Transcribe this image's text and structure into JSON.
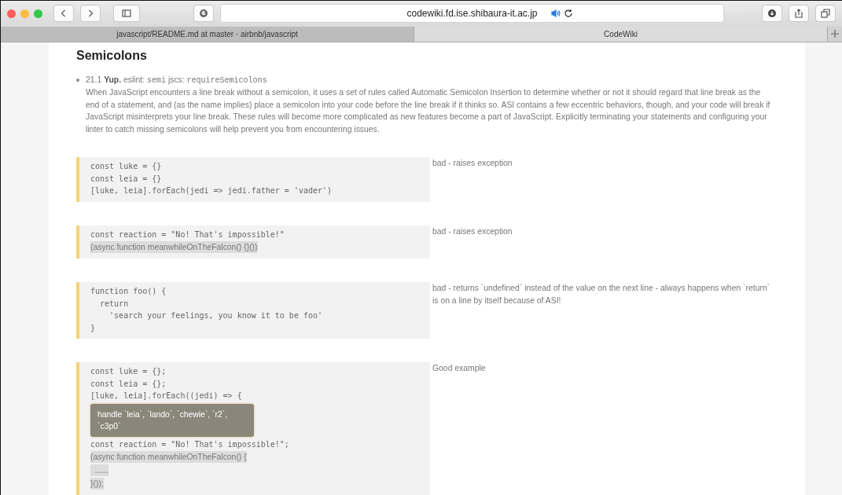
{
  "toolbar": {
    "url": "codewiki.fd.ise.shibaura-it.ac.jp"
  },
  "tabs": [
    {
      "label": "javascript/README.md at master · airbnb/javascript",
      "selected": false
    },
    {
      "label": "CodeWiki",
      "selected": true
    }
  ],
  "heading": "Semicolons",
  "rule": {
    "number": "21.1",
    "title": "Yup.",
    "eslint_label": "eslint:",
    "eslint_rule": "semi",
    "jscs_label": "jscs:",
    "jscs_rule": "requireSemicolons",
    "text": "When JavaScript encounters a line break without a semicolon, it uses a set of rules called Automatic Semicolon Insertion to determine whether or not it should regard that line break as the end of a statement, and (as the name implies) place a semicolon into your code before the line break if it thinks so. ASI contains a few eccentric behaviors, though, and your code will break if JavaScript misinterprets your line break. These rules will become more complicated as new features become a part of JavaScript. Explicitly terminating your statements and configuring your linter to catch missing semicolons will help prevent you from encountering issues."
  },
  "examples": [
    {
      "note": "bad - raises exception",
      "lines": [
        {
          "kind": "code",
          "text": "const luke = {}"
        },
        {
          "kind": "code",
          "text": "const leia = {}"
        },
        {
          "kind": "code",
          "text": "[luke, leia].forEach(jedi => jedi.father = 'vader')"
        }
      ]
    },
    {
      "note": "bad - raises exception",
      "lines": [
        {
          "kind": "code",
          "text": "const reaction = \"No! That's impossible!\""
        },
        {
          "kind": "highlight",
          "text": "(async function meanwhileOnTheFalcon() {}())"
        }
      ]
    },
    {
      "note": "bad - returns `undefined` instead of the value on the next line - always happens when `return` is on a line by itself because of ASI!",
      "lines": [
        {
          "kind": "code",
          "text": "function foo() {"
        },
        {
          "kind": "code",
          "text": "  return"
        },
        {
          "kind": "code",
          "text": "    'search your feelings, you know it to be foo'"
        },
        {
          "kind": "code",
          "text": "}"
        }
      ]
    },
    {
      "note": "Good example",
      "lines": [
        {
          "kind": "code",
          "text": "const luke = {};"
        },
        {
          "kind": "code",
          "text": "const leia = {};"
        },
        {
          "kind": "code",
          "text": "[luke, leia].forEach((jedi) => {"
        },
        {
          "kind": "tooltip",
          "text": "handle `leia`, `lando`, `chewie`, `r2`, `c3p0`"
        },
        {
          "kind": "code",
          "text": "const reaction = \"No! That's impossible!\";"
        },
        {
          "kind": "highlight",
          "text": "(async function meanwhileOnTheFalcon() {"
        },
        {
          "kind": "highlight",
          "text": "  ......"
        },
        {
          "kind": "highlight",
          "text": "}());"
        }
      ]
    }
  ]
}
